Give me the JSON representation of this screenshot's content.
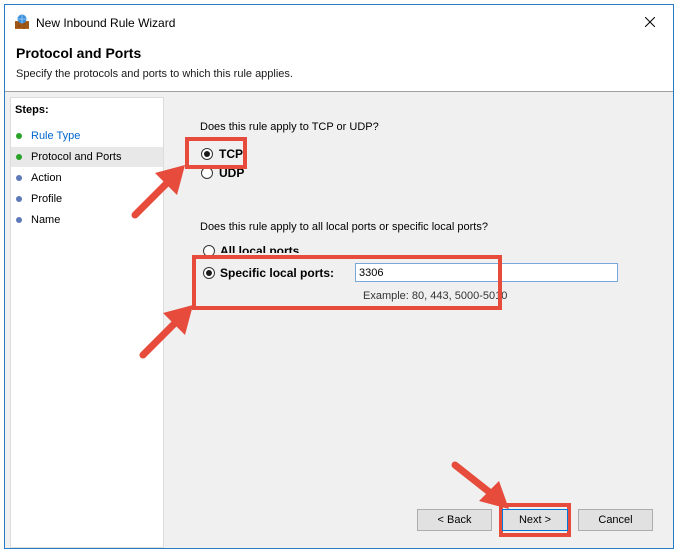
{
  "window": {
    "title": "New Inbound Rule Wizard"
  },
  "header": {
    "title": "Protocol and Ports",
    "subtitle": "Specify the protocols and ports to which this rule applies."
  },
  "sidebar": {
    "label": "Steps:",
    "items": [
      {
        "label": "Rule Type"
      },
      {
        "label": "Protocol and Ports"
      },
      {
        "label": "Action"
      },
      {
        "label": "Profile"
      },
      {
        "label": "Name"
      }
    ]
  },
  "protocol": {
    "question": "Does this rule apply to TCP or UDP?",
    "options": [
      {
        "label": "TCP",
        "selected": true
      },
      {
        "label": "UDP",
        "selected": false
      }
    ]
  },
  "ports": {
    "question": "Does this rule apply to all local ports or specific local ports?",
    "options": [
      {
        "label": "All local ports",
        "selected": false
      },
      {
        "label": "Specific local ports:",
        "selected": true
      }
    ],
    "value": "3306",
    "example": "Example: 80, 443, 5000-5010"
  },
  "buttons": {
    "back": "< Back",
    "next": "Next >",
    "cancel": "Cancel"
  },
  "colors": {
    "highlight": "#e64b3c",
    "accent": "#0078d7",
    "link": "#0066cc"
  },
  "icons": {
    "app": "firewall-icon",
    "close": "close-icon"
  }
}
